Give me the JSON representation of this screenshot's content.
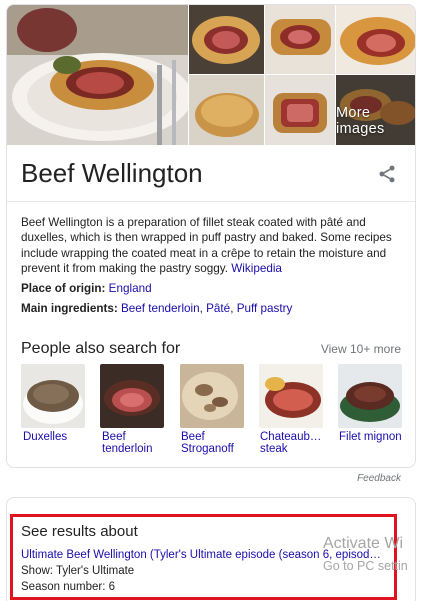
{
  "images": {
    "more_label": "More images"
  },
  "entity": {
    "title": "Beef Wellington",
    "description": "Beef Wellington is a preparation of fillet steak coated with pâté and duxelles, which is then wrapped in puff pastry and baked. Some recipes include wrapping the coated meat in a crêpe to retain the moisture and prevent it from making the pastry soggy.",
    "source_link": "Wikipedia",
    "origin_label": "Place of origin:",
    "origin_value": "England",
    "ingredients_label": "Main ingredients:",
    "ingredients": [
      "Beef tenderloin",
      "Pâté",
      "Puff pastry"
    ],
    "ingredient_sep": ", "
  },
  "people_also_search": {
    "title": "People also search for",
    "more_label": "View 10+ more",
    "items": [
      {
        "label": "Duxelles"
      },
      {
        "label": "Beef tenderloin"
      },
      {
        "label": "Beef Stroganoff"
      },
      {
        "label": "Chateaub… steak"
      },
      {
        "label": "Filet mignon"
      }
    ]
  },
  "feedback_label": "Feedback",
  "see_results": {
    "title": "See results about",
    "link": "Ultimate Beef Wellington (Tyler's Ultimate episode (season 6, episod…",
    "show_line": "Show: Tyler's Ultimate",
    "season_line": "Season number: 6"
  },
  "watermark": {
    "line1": "Activate Wi",
    "line2": "Go to PC settin"
  },
  "colors": {
    "link": "#1a0dab",
    "highlight": "#e0141e",
    "muted": "#70757a"
  }
}
